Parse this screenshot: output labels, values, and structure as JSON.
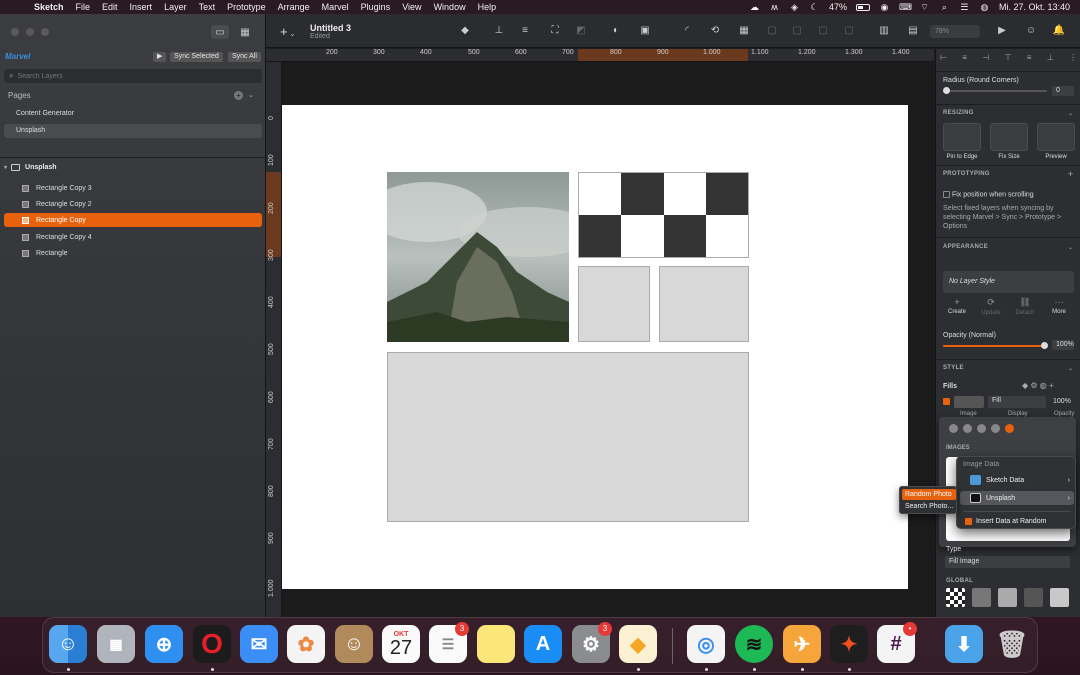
{
  "menubar": {
    "app_name": "Sketch",
    "menus": [
      "File",
      "Edit",
      "Insert",
      "Layer",
      "Text",
      "Prototype",
      "Arrange",
      "Marvel",
      "Plugins",
      "View",
      "Window",
      "Help"
    ],
    "battery": "47%",
    "datetime": "Mi. 27. Okt.  13:40",
    "notification_count": "1",
    "battery_level": 0.47
  },
  "toolbar": {
    "doc_title": "Untitled 3",
    "doc_status": "Edited",
    "zoom": "78%"
  },
  "sidebar": {
    "marvel_label": "Marvel",
    "sync_selected": "Sync Selected",
    "sync_all": "Sync All",
    "search_placeholder": "Search Layers",
    "pages_header": "Pages",
    "pages": [
      {
        "label": "Content Generator"
      },
      {
        "label": "Unsplash"
      }
    ],
    "artboard": "Unsplash",
    "layers": [
      {
        "label": "Rectangle Copy 3"
      },
      {
        "label": "Rectangle Copy 2"
      },
      {
        "label": "Rectangle Copy"
      },
      {
        "label": "Rectangle Copy 4"
      },
      {
        "label": "Rectangle"
      }
    ]
  },
  "rulers": {
    "h_ticks": [
      "200",
      "300",
      "400",
      "500",
      "600",
      "700",
      "800",
      "900",
      "1.000",
      "1.100",
      "1.200",
      "1.300",
      "1.400"
    ],
    "v_ticks": [
      "0",
      "100",
      "200",
      "300",
      "400",
      "500",
      "600",
      "700",
      "800",
      "900",
      "1.000"
    ]
  },
  "inspector": {
    "radius_label": "Radius (Round Corners)",
    "radius_value": "0",
    "resizing_title": "RESIZING",
    "resizing_options": [
      "Pin to Edge",
      "Fix Size",
      "Preview"
    ],
    "prototyping_title": "PROTOTYPING",
    "fix_position_label": "Fix position when scrolling",
    "prototyping_help": "Select fixed layers when syncing by selecting Marvel > Sync > Prototype > Options",
    "appearance_title": "APPEARANCE",
    "layer_style": "No Layer Style",
    "actions": [
      "Create",
      "Update",
      "Detach",
      "More"
    ],
    "opacity_label": "Opacity (Normal)",
    "opacity_value": "100%",
    "style_title": "STYLE",
    "fills_label": "Fills",
    "fill_mode": "Fill",
    "fill_opacity": "100%",
    "fill_sublabels": [
      "Image",
      "Display",
      "Opacity"
    ],
    "images_title": "IMAGES",
    "type_label": "Type",
    "type_value": "Fill Image",
    "global_title": "GLOBAL"
  },
  "data_menu": {
    "header": "Image Data",
    "items": [
      {
        "label": "Sketch Data"
      },
      {
        "label": "Unsplash"
      }
    ],
    "insert_random": "Insert Data at Random"
  },
  "sub_menu": {
    "items": [
      "Random Photo",
      "Search Photo..."
    ]
  },
  "dock": {
    "calendar_month": "OKT",
    "calendar_day": "27",
    "reminders_badge": "3",
    "settings_badge": "3",
    "slack_badge": "•"
  }
}
